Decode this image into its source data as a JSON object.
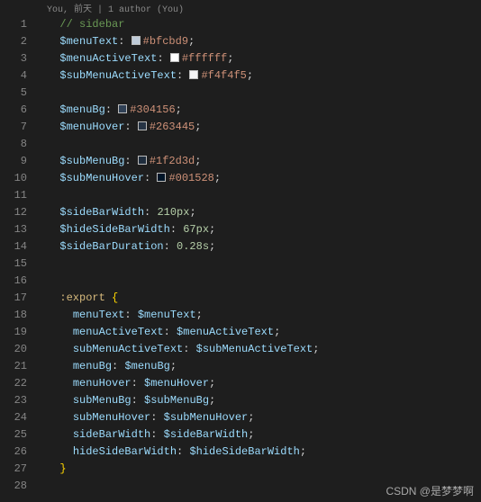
{
  "authorship": "You, 前天 | 1 author (You)",
  "watermark": "CSDN @是梦梦啊",
  "lines": [
    {
      "n": 1,
      "indent": 1,
      "tokens": [
        {
          "t": "comment",
          "v": "// sidebar"
        }
      ]
    },
    {
      "n": 2,
      "indent": 1,
      "tokens": [
        {
          "t": "var",
          "v": "$menuText"
        },
        {
          "t": "punct",
          "v": ": "
        },
        {
          "t": "swatch",
          "c": "#bfcbd9"
        },
        {
          "t": "string",
          "v": "#bfcbd9"
        },
        {
          "t": "punct",
          "v": ";"
        }
      ]
    },
    {
      "n": 3,
      "indent": 1,
      "tokens": [
        {
          "t": "var",
          "v": "$menuActiveText"
        },
        {
          "t": "punct",
          "v": ": "
        },
        {
          "t": "swatch",
          "c": "#ffffff"
        },
        {
          "t": "string",
          "v": "#ffffff"
        },
        {
          "t": "punct",
          "v": ";"
        }
      ]
    },
    {
      "n": 4,
      "indent": 1,
      "tokens": [
        {
          "t": "var",
          "v": "$subMenuActiveText"
        },
        {
          "t": "punct",
          "v": ": "
        },
        {
          "t": "swatch",
          "c": "#f4f4f5"
        },
        {
          "t": "string",
          "v": "#f4f4f5"
        },
        {
          "t": "punct",
          "v": ";"
        }
      ]
    },
    {
      "n": 5,
      "indent": 1,
      "tokens": []
    },
    {
      "n": 6,
      "indent": 1,
      "tokens": [
        {
          "t": "var",
          "v": "$menuBg"
        },
        {
          "t": "punct",
          "v": ": "
        },
        {
          "t": "swatch",
          "c": "#304156"
        },
        {
          "t": "string",
          "v": "#304156"
        },
        {
          "t": "punct",
          "v": ";"
        }
      ]
    },
    {
      "n": 7,
      "indent": 1,
      "tokens": [
        {
          "t": "var",
          "v": "$menuHover"
        },
        {
          "t": "punct",
          "v": ": "
        },
        {
          "t": "swatch",
          "c": "#263445"
        },
        {
          "t": "string",
          "v": "#263445"
        },
        {
          "t": "punct",
          "v": ";"
        }
      ]
    },
    {
      "n": 8,
      "indent": 1,
      "tokens": []
    },
    {
      "n": 9,
      "indent": 1,
      "tokens": [
        {
          "t": "var",
          "v": "$subMenuBg"
        },
        {
          "t": "punct",
          "v": ": "
        },
        {
          "t": "swatch",
          "c": "#1f2d3d"
        },
        {
          "t": "string",
          "v": "#1f2d3d"
        },
        {
          "t": "punct",
          "v": ";"
        }
      ]
    },
    {
      "n": 10,
      "indent": 1,
      "tokens": [
        {
          "t": "var",
          "v": "$subMenuHover"
        },
        {
          "t": "punct",
          "v": ": "
        },
        {
          "t": "swatch",
          "c": "#001528"
        },
        {
          "t": "string",
          "v": "#001528"
        },
        {
          "t": "punct",
          "v": ";"
        }
      ]
    },
    {
      "n": 11,
      "indent": 1,
      "tokens": []
    },
    {
      "n": 12,
      "indent": 1,
      "tokens": [
        {
          "t": "var",
          "v": "$sideBarWidth"
        },
        {
          "t": "punct",
          "v": ": "
        },
        {
          "t": "num",
          "v": "210px"
        },
        {
          "t": "punct",
          "v": ";"
        }
      ]
    },
    {
      "n": 13,
      "indent": 1,
      "tokens": [
        {
          "t": "var",
          "v": "$hideSideBarWidth"
        },
        {
          "t": "punct",
          "v": ": "
        },
        {
          "t": "num",
          "v": "67px"
        },
        {
          "t": "punct",
          "v": ";"
        }
      ]
    },
    {
      "n": 14,
      "indent": 1,
      "tokens": [
        {
          "t": "var",
          "v": "$sideBarDuration"
        },
        {
          "t": "punct",
          "v": ": "
        },
        {
          "t": "num",
          "v": "0.28s"
        },
        {
          "t": "punct",
          "v": ";"
        }
      ]
    },
    {
      "n": 15,
      "indent": 1,
      "tokens": []
    },
    {
      "n": 16,
      "indent": 0,
      "tokens": []
    },
    {
      "n": 17,
      "indent": 1,
      "tokens": [
        {
          "t": "sel",
          "v": ":export"
        },
        {
          "t": "punct",
          "v": " "
        },
        {
          "t": "brace",
          "v": "{"
        }
      ]
    },
    {
      "n": 18,
      "indent": 2,
      "tokens": [
        {
          "t": "prop",
          "v": "menuText"
        },
        {
          "t": "punct",
          "v": ": "
        },
        {
          "t": "var",
          "v": "$menuText"
        },
        {
          "t": "punct",
          "v": ";"
        }
      ]
    },
    {
      "n": 19,
      "indent": 2,
      "tokens": [
        {
          "t": "prop",
          "v": "menuActiveText"
        },
        {
          "t": "punct",
          "v": ": "
        },
        {
          "t": "var",
          "v": "$menuActiveText"
        },
        {
          "t": "punct",
          "v": ";"
        }
      ]
    },
    {
      "n": 20,
      "indent": 2,
      "tokens": [
        {
          "t": "prop",
          "v": "subMenuActiveText"
        },
        {
          "t": "punct",
          "v": ": "
        },
        {
          "t": "var",
          "v": "$subMenuActiveText"
        },
        {
          "t": "punct",
          "v": ";"
        }
      ]
    },
    {
      "n": 21,
      "indent": 2,
      "tokens": [
        {
          "t": "prop",
          "v": "menuBg"
        },
        {
          "t": "punct",
          "v": ": "
        },
        {
          "t": "var",
          "v": "$menuBg"
        },
        {
          "t": "punct",
          "v": ";"
        }
      ]
    },
    {
      "n": 22,
      "indent": 2,
      "tokens": [
        {
          "t": "prop",
          "v": "menuHover"
        },
        {
          "t": "punct",
          "v": ": "
        },
        {
          "t": "var",
          "v": "$menuHover"
        },
        {
          "t": "punct",
          "v": ";"
        }
      ]
    },
    {
      "n": 23,
      "indent": 2,
      "tokens": [
        {
          "t": "prop",
          "v": "subMenuBg"
        },
        {
          "t": "punct",
          "v": ": "
        },
        {
          "t": "var",
          "v": "$subMenuBg"
        },
        {
          "t": "punct",
          "v": ";"
        }
      ]
    },
    {
      "n": 24,
      "indent": 2,
      "tokens": [
        {
          "t": "prop",
          "v": "subMenuHover"
        },
        {
          "t": "punct",
          "v": ": "
        },
        {
          "t": "var",
          "v": "$subMenuHover"
        },
        {
          "t": "punct",
          "v": ";"
        }
      ]
    },
    {
      "n": 25,
      "indent": 2,
      "tokens": [
        {
          "t": "prop",
          "v": "sideBarWidth"
        },
        {
          "t": "punct",
          "v": ": "
        },
        {
          "t": "var",
          "v": "$sideBarWidth"
        },
        {
          "t": "punct",
          "v": ";"
        }
      ]
    },
    {
      "n": 26,
      "indent": 2,
      "tokens": [
        {
          "t": "prop",
          "v": "hideSideBarWidth"
        },
        {
          "t": "punct",
          "v": ": "
        },
        {
          "t": "var",
          "v": "$hideSideBarWidth"
        },
        {
          "t": "punct",
          "v": ";"
        }
      ]
    },
    {
      "n": 27,
      "indent": 1,
      "tokens": [
        {
          "t": "brace",
          "v": "}"
        }
      ]
    },
    {
      "n": 28,
      "indent": 1,
      "tokens": []
    }
  ]
}
